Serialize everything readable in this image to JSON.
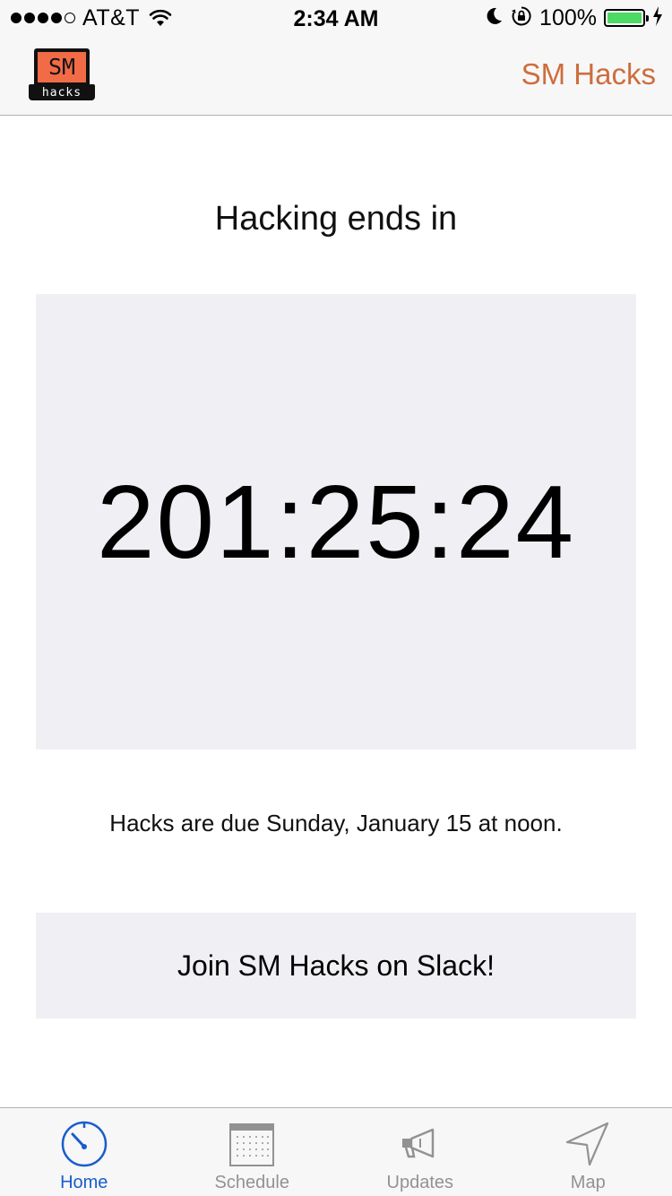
{
  "status_bar": {
    "carrier": "AT&T",
    "time": "2:34 AM",
    "battery_percent": "100%",
    "signal_bars_filled": 4,
    "signal_bars_total": 5
  },
  "nav_bar": {
    "logo_text": "SM",
    "logo_subtext": "hacks",
    "title": "SM Hacks"
  },
  "main": {
    "headline": "Hacking ends in",
    "countdown": "201:25:24",
    "due_text": "Hacks are due Sunday, January 15 at noon.",
    "slack_button_label": "Join SM Hacks on Slack!"
  },
  "tab_bar": {
    "tabs": [
      {
        "label": "Home",
        "icon": "timer-icon",
        "active": true
      },
      {
        "label": "Schedule",
        "icon": "calendar-icon",
        "active": false
      },
      {
        "label": "Updates",
        "icon": "megaphone-icon",
        "active": false
      },
      {
        "label": "Map",
        "icon": "location-arrow-icon",
        "active": false
      }
    ]
  },
  "colors": {
    "accent": "#cd6d3e",
    "tab_active": "#1a5ccc",
    "tab_inactive": "#929292",
    "panel_background": "#efeff4",
    "logo_orange": "#f26b47",
    "battery_green": "#4cd964"
  }
}
